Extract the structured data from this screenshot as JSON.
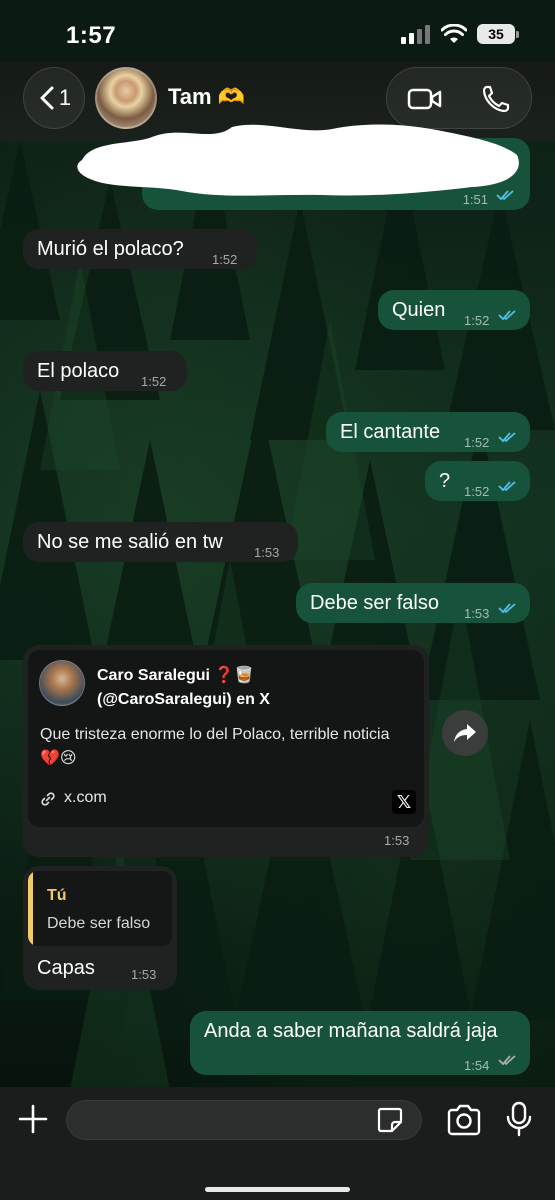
{
  "status_bar": {
    "time": "1:57",
    "battery": "35"
  },
  "header": {
    "back_count": "1",
    "contact_name": "Tam 🫶"
  },
  "messages": [
    {
      "direction": "out",
      "time": "1:51",
      "redacted": true
    },
    {
      "direction": "in",
      "text": "Murió el polaco?",
      "time": "1:52"
    },
    {
      "direction": "out",
      "text": "Quien",
      "time": "1:52"
    },
    {
      "direction": "in",
      "text": "El polaco",
      "time": "1:52"
    },
    {
      "direction": "out",
      "text": "El cantante",
      "time": "1:52"
    },
    {
      "direction": "out",
      "text": "?",
      "time": "1:52"
    },
    {
      "direction": "in",
      "text": "No se me salió en tw",
      "time": "1:53"
    },
    {
      "direction": "out",
      "text": "Debe ser falso",
      "time": "1:53"
    }
  ],
  "link_preview": {
    "author_name": "Caro Saralegui ❓🥃",
    "author_handle": "(@CaroSaralegui) en X",
    "body": "Que tristeza enorme lo del Polaco, terrible noticia 💔😢",
    "url": "x.com",
    "site_logo": "𝕏",
    "time": "1:53"
  },
  "reply_message": {
    "quoted_sender": "Tú",
    "quoted_text": "Debe ser falso",
    "text": "Capas",
    "time": "1:53"
  },
  "last_message": {
    "direction": "out",
    "text": "Anda a saber mañana saldrá jaja",
    "time": "1:54",
    "read": false
  },
  "input": {
    "placeholder": ""
  },
  "colors": {
    "outgoing_bubble": "#16533a",
    "incoming_bubble": "#1f2221",
    "read_ticks": "#53bdeb",
    "unread_ticks": "#a7b0ab",
    "reply_accent": "#f2cc6b"
  }
}
